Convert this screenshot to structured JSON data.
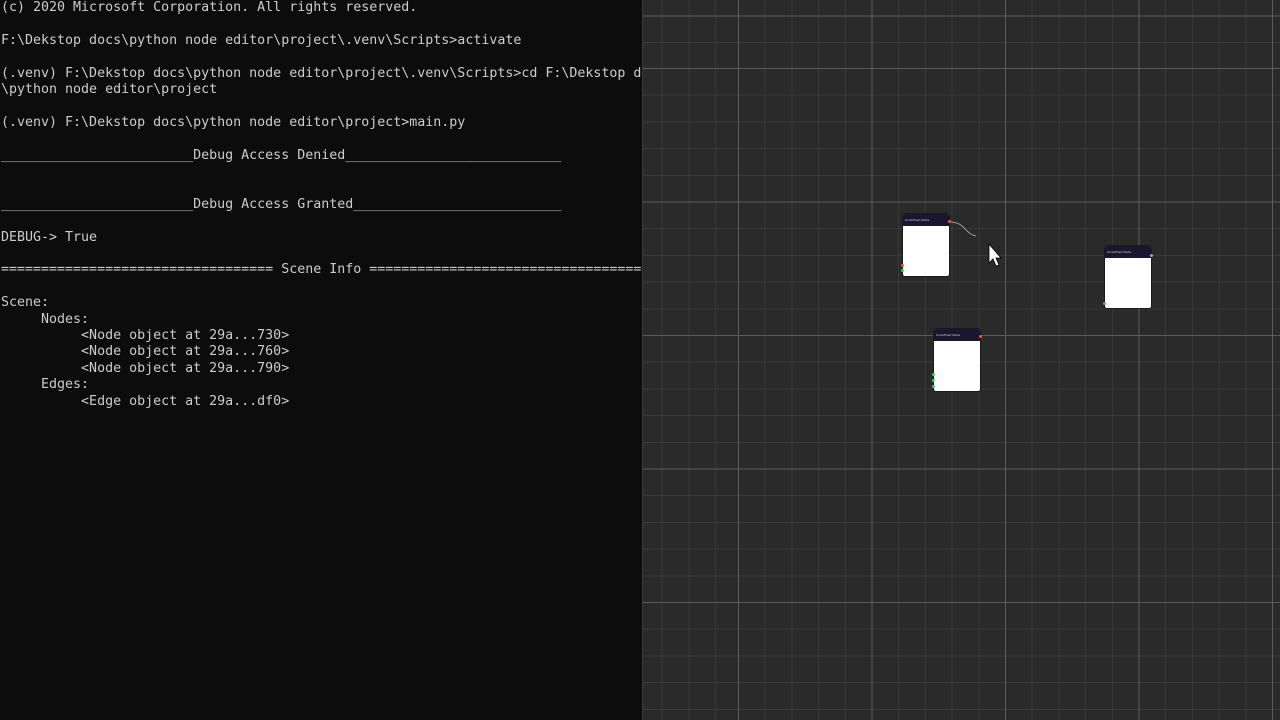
{
  "terminal": {
    "lines": [
      "(c) 2020 Microsoft Corporation. All rights reserved.",
      "",
      "F:\\Dekstop docs\\python node editor\\project\\.venv\\Scripts>activate",
      "",
      "(.venv) F:\\Dekstop docs\\python node editor\\project\\.venv\\Scripts>cd F:\\Dekstop docs",
      "\\python node editor\\project",
      "",
      "(.venv) F:\\Dekstop docs\\python node editor\\project>main.py",
      "",
      "________________________Debug Access Denied___________________________",
      "",
      "",
      "________________________Debug Access Granted__________________________",
      "",
      "DEBUG-> True",
      "",
      "================================== Scene Info ===================================",
      "",
      "Scene:",
      "     Nodes:",
      "          <Node object at 29a...730>",
      "          <Node object at 29a...760>",
      "          <Node object at 29a...790>",
      "     Edges:",
      "          <Edge object at 29a...df0>"
    ]
  },
  "node_editor": {
    "background": "#2a2a2a",
    "node_title_color": "#1b1530",
    "node_body_color": "#ffffff",
    "socket_colors": {
      "red": "#ff5050",
      "green": "#35d46b",
      "purple": "#b070ff",
      "cyan": "#40c8e0"
    },
    "edge_color": "#9a9a9a",
    "nodes": [
      {
        "title": "Undefined Node",
        "content": ""
      },
      {
        "title": "Undefined Node",
        "content": ""
      },
      {
        "title": "Undefined Node",
        "content": ""
      }
    ]
  }
}
